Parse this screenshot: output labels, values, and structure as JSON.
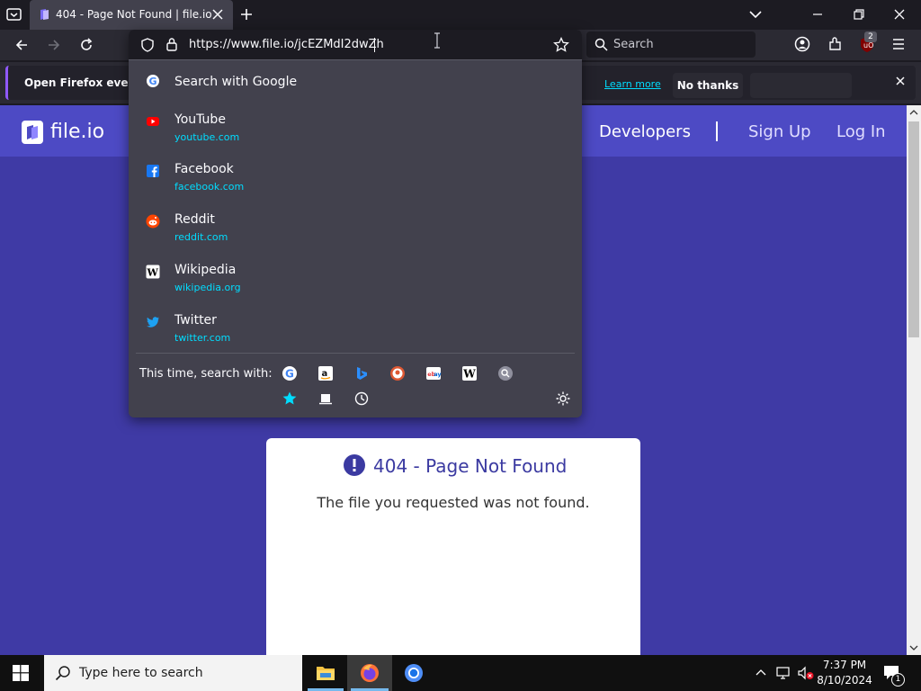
{
  "browser": {
    "tab": {
      "title": "404 - Page Not Found | file.io"
    },
    "url": "https://www.file.io/jcEZMdI2dwZh",
    "search_placeholder": "Search",
    "extension_badge": "2"
  },
  "notification": {
    "text": "Open Firefox every time",
    "learn_more": "Learn more",
    "no_thanks": "No thanks"
  },
  "dropdown": {
    "search_with": "Search with Google",
    "suggestions": [
      {
        "title": "YouTube",
        "url": "youtube.com",
        "icon": "youtube-icon",
        "color": "#ff0000"
      },
      {
        "title": "Facebook",
        "url": "facebook.com",
        "icon": "facebook-icon",
        "color": "#1877f2"
      },
      {
        "title": "Reddit",
        "url": "reddit.com",
        "icon": "reddit-icon",
        "color": "#ff4500"
      },
      {
        "title": "Wikipedia",
        "url": "wikipedia.org",
        "icon": "wikipedia-icon",
        "color": "#ffffff"
      },
      {
        "title": "Twitter",
        "url": "twitter.com",
        "icon": "twitter-icon",
        "color": "#1da1f2"
      }
    ],
    "this_time_label": "This time, search with:",
    "engines": [
      "google-icon",
      "amazon-icon",
      "bing-icon",
      "duckduckgo-icon",
      "ebay-icon",
      "wikipedia-icon",
      "search-icon",
      "bookmarks-icon",
      "tabs-icon",
      "history-icon"
    ]
  },
  "site": {
    "logo": "file.io",
    "nav": [
      "Developers",
      "Sign Up",
      "Log In"
    ],
    "error_title": "404 - Page Not Found",
    "error_message": "The file you requested was not found."
  },
  "taskbar": {
    "search_placeholder": "Type here to search",
    "time": "7:37 PM",
    "date": "8/10/2024",
    "notification_count": "1"
  },
  "colors": {
    "accent": "#9059ff",
    "link": "#00ddff",
    "page_bg": "#3f3aa5",
    "header_bg": "#4d4ac4"
  }
}
